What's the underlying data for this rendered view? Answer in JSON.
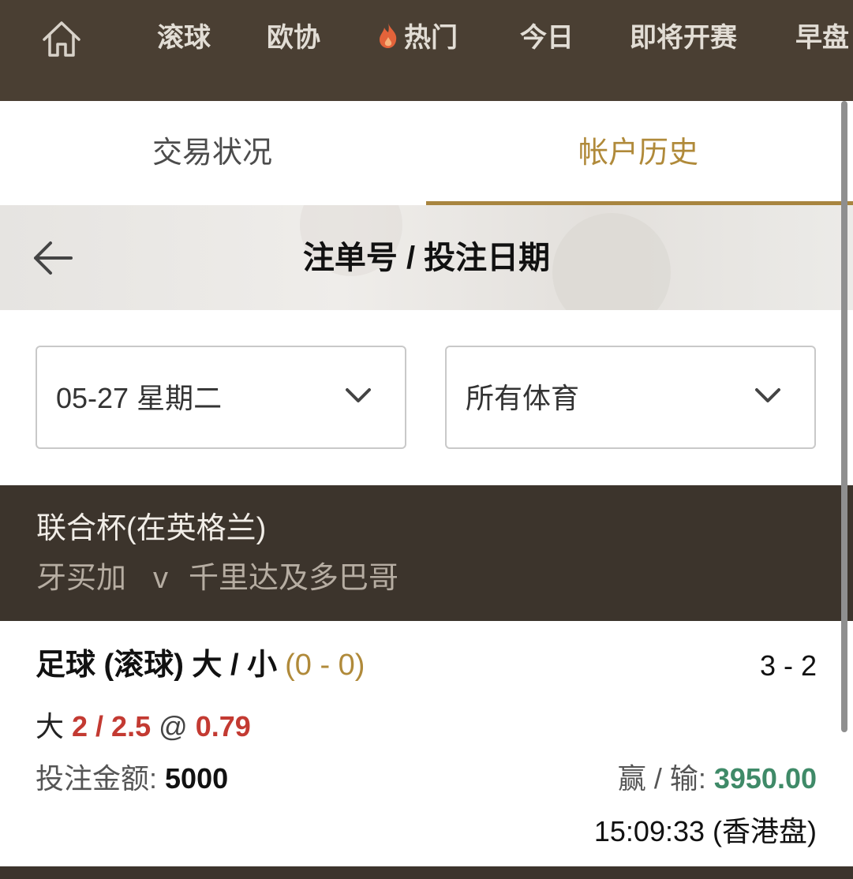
{
  "colors": {
    "nav_bg": "#4a3f33",
    "accent_gold": "#b08a3a",
    "match_header_bg": "#3c342c",
    "odds_red": "#c33a32",
    "win_green": "#3f8a68"
  },
  "topnav": {
    "home_icon": "home-icon",
    "items": [
      "滚球",
      "欧协",
      "热门",
      "今日",
      "即将开赛",
      "早盘"
    ],
    "hot_icon": "flame-icon"
  },
  "tabs": {
    "trading": "交易状况",
    "history": "帐户历史",
    "active": "history"
  },
  "header": {
    "back_icon": "arrow-left-icon",
    "title": "注单号 / 投注日期"
  },
  "filters": {
    "date": "05-27 星期二",
    "sport": "所有体育",
    "dropdown_icon": "chevron-down-icon"
  },
  "match": {
    "league": "联合杯(在英格兰)",
    "home": "牙买加",
    "vs": "v",
    "away": "千里达及多巴哥"
  },
  "bet": {
    "type": "足球 (滚球) 大 / 小",
    "state_score": "(0 - 0)",
    "final_score": "3 - 2",
    "pick": "大",
    "line": "2 / 2.5",
    "at": "@",
    "odds": "0.79",
    "stake_label": "投注金额:",
    "stake": "5000",
    "winloss_label": "赢 / 输:",
    "winloss": "3950.00",
    "time": "15:09:33 (香港盘)"
  }
}
